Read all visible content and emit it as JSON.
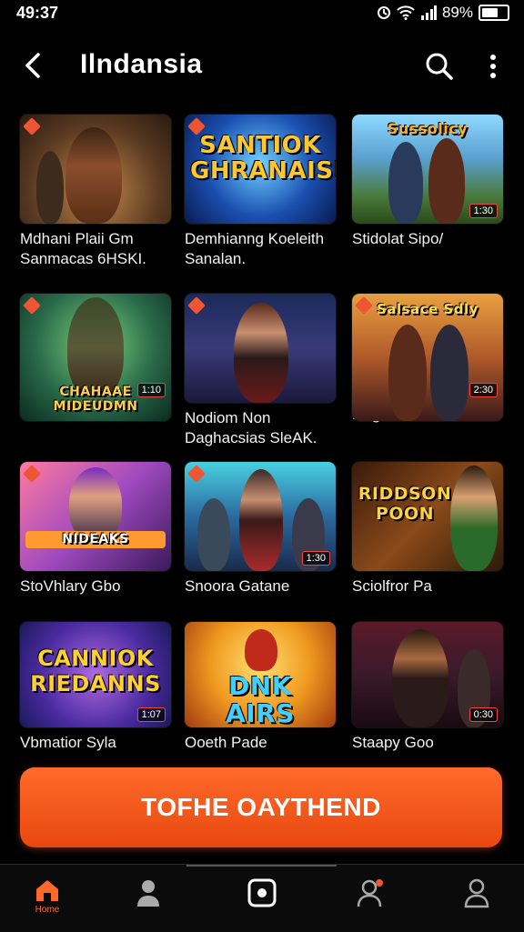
{
  "status": {
    "time": "49:37",
    "battery": "89%"
  },
  "header": {
    "title": "Ilndansia",
    "back_icon": "chevron-left-icon",
    "search_icon": "search-icon",
    "more_icon": "more-vertical-icon"
  },
  "games": [
    {
      "title_line1": "Mdhani Plaii Gm",
      "title_line2": "Sanmacas 6HSKI.",
      "logo": "",
      "badge": ""
    },
    {
      "title_line1": "Demhianng Koeleith",
      "title_line2": "Sanalan.",
      "logo": "SANTIOK GHRANAISN",
      "badge": ""
    },
    {
      "title_line1": "Stidolat Sipo/",
      "title_line2": "",
      "logo": "Sussolicy",
      "badge": "1:30"
    },
    {
      "title_line1": "",
      "title_line2": "",
      "logo": "CHAHAAE MIDEUDMN",
      "badge": "1:10"
    },
    {
      "title_line1": "Nodiom Non",
      "title_line2": "Daghacsias SleAK.",
      "logo": "",
      "badge": ""
    },
    {
      "title_line1": "Dagai",
      "title_line2": "",
      "logo": "Salsace Sdly",
      "badge": "2:30"
    },
    {
      "title_line1": "StoVhlary Gbo",
      "title_line2": "",
      "logo": "NIDEAKS",
      "badge": ""
    },
    {
      "title_line1": "Snoora Gatane",
      "title_line2": "",
      "logo": "",
      "badge": "1:30"
    },
    {
      "title_line1": "Sciolfror Pa",
      "title_line2": "",
      "logo": "RIDDSON POON",
      "badge": ""
    },
    {
      "title_line1": "Vbmatior Syla",
      "title_line2": "",
      "logo": "CANNIOK RIEDANNS",
      "badge": "1:07"
    },
    {
      "title_line1": "Ooeth Pade",
      "title_line2": "",
      "logo": "DNK AIRS",
      "badge": ""
    },
    {
      "title_line1": "Staapy Goo",
      "title_line2": "",
      "logo": "",
      "badge": "0:30"
    }
  ],
  "cta": {
    "label": "TOFHE OAYTHEND"
  },
  "nav": {
    "items": [
      {
        "icon": "home-icon",
        "label": "Home",
        "active": true
      },
      {
        "icon": "profile-icon",
        "label": "",
        "active": false
      },
      {
        "icon": "camera-icon",
        "label": "",
        "active": false
      },
      {
        "icon": "friends-icon",
        "label": "",
        "active": false
      },
      {
        "icon": "user-icon",
        "label": "",
        "active": false
      }
    ]
  },
  "colors": {
    "accent": "#ff6a2a",
    "background": "#000000"
  }
}
